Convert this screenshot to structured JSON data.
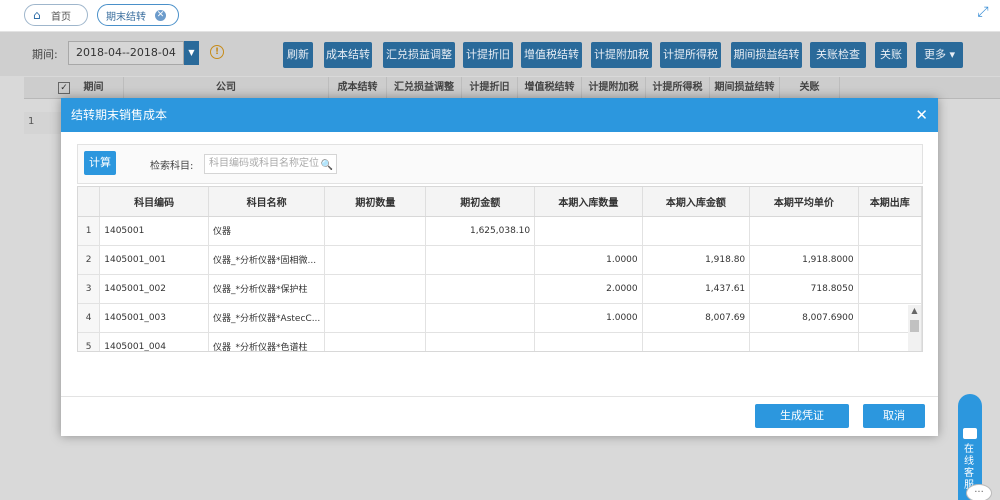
{
  "tabs": [
    {
      "label": "首页"
    },
    {
      "label": "期末结转"
    }
  ],
  "toolbar": {
    "period_label": "期间:",
    "period_value": "2018-04--2018-04",
    "buttons": [
      {
        "label": "刷新"
      },
      {
        "label": "成本结转"
      },
      {
        "label": "汇兑损益调整"
      },
      {
        "label": "计提折旧"
      },
      {
        "label": "增值税结转"
      },
      {
        "label": "计提附加税"
      },
      {
        "label": "计提所得税"
      },
      {
        "label": "期间损益结转"
      },
      {
        "label": "关账检查"
      },
      {
        "label": "关账"
      },
      {
        "label": "更多 ▾"
      }
    ]
  },
  "bg_grid": {
    "headers": [
      "期间",
      "公司",
      "成本结转",
      "汇兑损益调整",
      "计提折旧",
      "增值税结转",
      "计提附加税",
      "计提所得税",
      "期间损益结转",
      "关账"
    ],
    "row_index": "1"
  },
  "modal": {
    "title": "结转期末销售成本",
    "calc_label": "计算",
    "search_label": "检索科目:",
    "search_placeholder": "科目编码或科目名称定位",
    "columns": [
      "",
      "科目编码",
      "科目名称",
      "期初数量",
      "期初金额",
      "本期入库数量",
      "本期入库金额",
      "本期平均单价",
      "本期出库"
    ],
    "rows": [
      {
        "idx": "1",
        "code": "1405001",
        "name": "仪器",
        "open_qty": "",
        "open_amt": "1,625,038.10",
        "in_qty": "",
        "in_amt": "",
        "avg_price": "",
        "out": ""
      },
      {
        "idx": "2",
        "code": "1405001_001",
        "name": "仪器_*分析仪器*固相微...",
        "open_qty": "",
        "open_amt": "",
        "in_qty": "1.0000",
        "in_amt": "1,918.80",
        "avg_price": "1,918.8000",
        "out": ""
      },
      {
        "idx": "3",
        "code": "1405001_002",
        "name": "仪器_*分析仪器*保护柱",
        "open_qty": "",
        "open_amt": "",
        "in_qty": "2.0000",
        "in_amt": "1,437.61",
        "avg_price": "718.8050",
        "out": ""
      },
      {
        "idx": "4",
        "code": "1405001_003",
        "name": "仪器_*分析仪器*AstecC...",
        "open_qty": "",
        "open_amt": "",
        "in_qty": "1.0000",
        "in_amt": "8,007.69",
        "avg_price": "8,007.6900",
        "out": ""
      },
      {
        "idx": "5",
        "code": "1405001_004",
        "name": "仪器_*分析仪器*色谱柱",
        "open_qty": "",
        "open_amt": "",
        "in_qty": "",
        "in_amt": "",
        "avg_price": "",
        "out": ""
      }
    ],
    "generate_label": "生成凭证",
    "cancel_label": "取消"
  },
  "service": {
    "label": "在线客服"
  },
  "colors": {
    "primary": "#2c97de",
    "dark_button": "#2a6a9a",
    "overlay": "#d9d9d9"
  }
}
